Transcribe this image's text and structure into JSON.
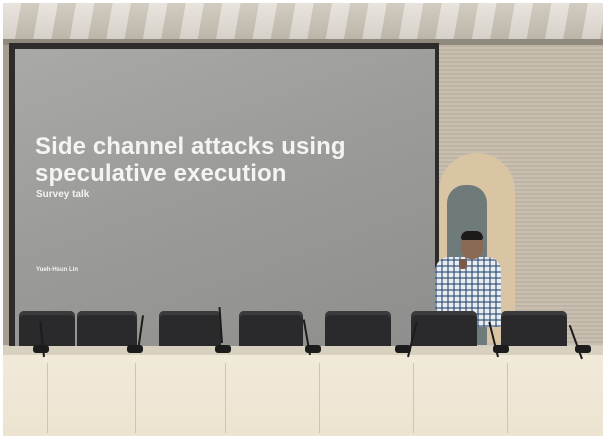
{
  "slide": {
    "title_line1": "Side channel attacks using",
    "title_line2": "speculative execution",
    "subtitle": "Survey talk",
    "author": "Yueh-Hsun Lin"
  }
}
